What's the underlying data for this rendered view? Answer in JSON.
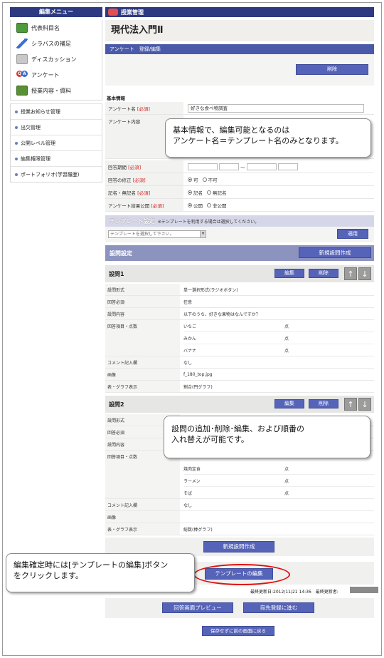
{
  "sidebar": {
    "header": "編集メニュー",
    "main_items": [
      {
        "label": "代表科目名",
        "icon": "map-icon"
      },
      {
        "label": "シラバスの補足",
        "icon": "pen-icon"
      },
      {
        "label": "ディスカッション",
        "icon": "discussion-icon"
      },
      {
        "label": "アンケート",
        "icon": "qa-icon"
      },
      {
        "label": "授業内容・資料",
        "icon": "book-icon"
      }
    ],
    "sub_items": [
      "授業お知らせ管理",
      "出欠管理",
      "公開レベル管理",
      "編集権限管理",
      "ポートフォリオ(学習履歴)"
    ]
  },
  "topbar": {
    "title": "授業管理"
  },
  "course_title": "現代法入門Ⅱ",
  "section_title": "アンケート　登録/編集",
  "delete_label": "削除",
  "basic_info": {
    "heading": "基本情報",
    "name_label": "アンケート名",
    "required": "[必須]",
    "name_value": "好きな食べ物調査",
    "content_label": "アンケート内容",
    "period_label": "回答期間",
    "period_sep": "〜",
    "correct_label": "回答の修正",
    "correct_opts": [
      "可",
      "不可"
    ],
    "signed_label": "記名・無記名",
    "signed_opts": [
      "記名",
      "無記名"
    ],
    "publish_label": "アンケート結果公開",
    "publish_opts": [
      "公開",
      "非公開"
    ]
  },
  "template": {
    "heading": "テンプレート設定",
    "note": "※テンプレートを利用する場合は選択してください。",
    "select_placeholder": "テンプレートを選択して下さい。",
    "apply_label": "適用"
  },
  "questions_heading": "設問設定",
  "new_question_label": "新規設問作成",
  "edit_label": "編集",
  "delete_small_label": "削除",
  "up_arrow": "↑",
  "down_arrow": "↓",
  "q_labels": {
    "format": "設問形式",
    "required": "回答必須",
    "content": "設問内容",
    "options": "回答項目・点数",
    "comment": "コメント記入欄",
    "image": "画像",
    "graph": "表・グラフ表示"
  },
  "q1": {
    "title": "設問1",
    "format": "単一選択形式(ラジオボタン)",
    "required": "任意",
    "content": "以下のうち、好きな果物はなんですか？",
    "options": [
      "いちご",
      "みかん",
      "バナナ"
    ],
    "points_label": "点",
    "comment": "なし",
    "image": "f_180_top.jpg",
    "graph": "割合(円グラフ)"
  },
  "q2": {
    "title": "設問2",
    "options": [
      "焼肉定食",
      "ラーメン",
      "そば"
    ],
    "points_label": "点",
    "comment": "なし",
    "graph": "総数(棒グラフ)"
  },
  "template_edit_label": "テンプレートの編集",
  "updated": "最終更新日:2012/11/21 14:36　最終更新者:",
  "preview_label": "回答画面プレビュー",
  "to_recipient_label": "宛先登録に進む",
  "back_label": "保存せずに前の画面に戻る",
  "callouts": {
    "c1_line1": "基本情報で、編集可能となるのは",
    "c1_line2": "アンケート名＝テンプレート名のみとなります。",
    "c2_line1": "設問の追加･削除･編集、および順番の",
    "c2_line2": "入れ替えが可能です。",
    "c3_line1": "編集確定時には[テンプレートの編集]ボタン",
    "c3_line2": "をクリックします。"
  }
}
